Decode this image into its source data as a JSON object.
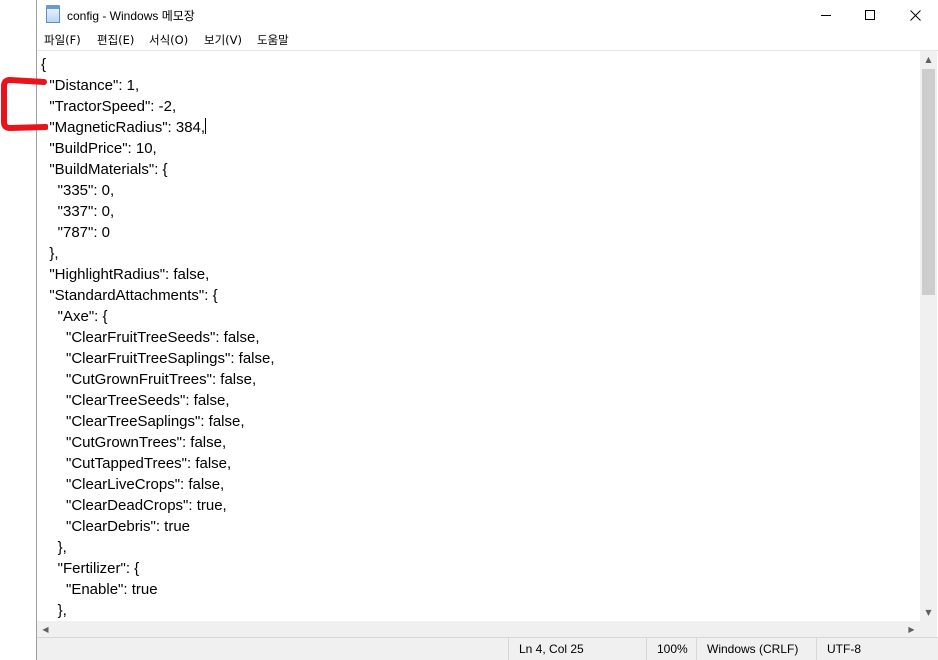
{
  "window": {
    "title": "config - Windows 메모장",
    "controls": {
      "minimize": "minimize-icon",
      "maximize": "maximize-icon",
      "close": "close-icon"
    }
  },
  "menu": {
    "file": "파일(F)",
    "edit": "편집(E)",
    "format": "서식(O)",
    "view": "보기(V)",
    "help": "도움말"
  },
  "editor": {
    "lines": [
      "{",
      "  \"Distance\": 1,",
      "  \"TractorSpeed\": -2,",
      "  \"MagneticRadius\": 384,",
      "  \"BuildPrice\": 10,",
      "  \"BuildMaterials\": {",
      "    \"335\": 0,",
      "    \"337\": 0,",
      "    \"787\": 0",
      "  },",
      "  \"HighlightRadius\": false,",
      "  \"StandardAttachments\": {",
      "    \"Axe\": {",
      "      \"ClearFruitTreeSeeds\": false,",
      "      \"ClearFruitTreeSaplings\": false,",
      "      \"CutGrownFruitTrees\": false,",
      "      \"ClearTreeSeeds\": false,",
      "      \"ClearTreeSaplings\": false,",
      "      \"CutGrownTrees\": false,",
      "      \"CutTappedTrees\": false,",
      "      \"ClearLiveCrops\": false,",
      "      \"ClearDeadCrops\": true,",
      "      \"ClearDebris\": true",
      "    },",
      "    \"Fertilizer\": {",
      "      \"Enable\": true",
      "    },"
    ]
  },
  "statusbar": {
    "position": "Ln 4, Col 25",
    "zoom": "100%",
    "line_ending": "Windows (CRLF)",
    "encoding": "UTF-8"
  },
  "colors": {
    "annotation": "#e8141b",
    "scrollbar_thumb": "#cdcdcd",
    "statusbar_bg": "#f0f0f0"
  }
}
